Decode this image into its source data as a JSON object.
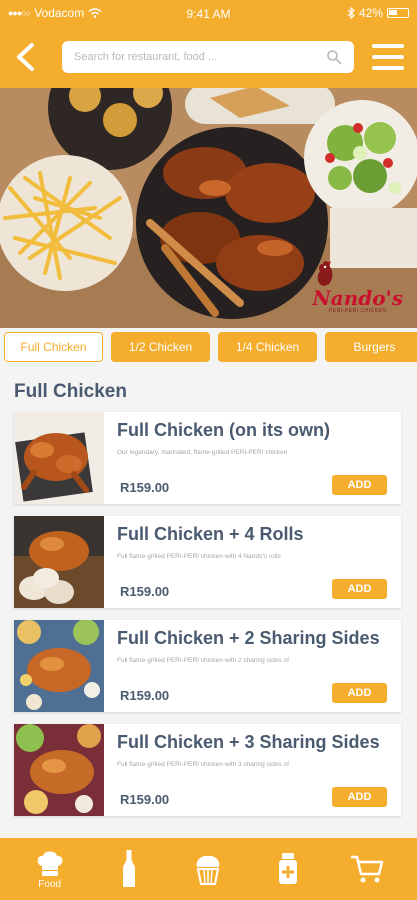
{
  "status": {
    "carrier": "Vodacom",
    "time": "9:41 AM",
    "battery": "42%"
  },
  "header": {
    "search_placeholder": "Search for restaurant, food ..."
  },
  "hero": {
    "brand": "Nando's",
    "brand_tagline": "PERI-PERI CHICKEN"
  },
  "tabs": [
    {
      "label": "Full Chicken",
      "active": true
    },
    {
      "label": "1/2 Chicken",
      "active": false
    },
    {
      "label": "1/4 Chicken",
      "active": false
    },
    {
      "label": "Burgers",
      "active": false
    }
  ],
  "section_title": "Full Chicken",
  "items": [
    {
      "name": "Full Chicken (on its own)",
      "description": "Our legendary, marinated, flame-grilled PERI-PERI chicken",
      "price": "R159.00",
      "add_label": "ADD"
    },
    {
      "name": "Full Chicken + 4 Rolls",
      "description": "Full flame-grilled PERI-PERI chicken with 4 Nando's rolls",
      "price": "R159.00",
      "add_label": "ADD"
    },
    {
      "name": "Full Chicken + 2 Sharing Sides",
      "description": "Full flame-grilled PERI-PERI chicken with 2 sharing sides of",
      "price": "R159.00",
      "add_label": "ADD"
    },
    {
      "name": "Full Chicken + 3 Sharing Sides",
      "description": "Full flame-grilled PERI-PERI chicken with 3 sharing sides of",
      "price": "R159.00",
      "add_label": "ADD"
    }
  ],
  "bottom_nav": [
    {
      "icon": "chef-hat-icon",
      "label": "Food"
    },
    {
      "icon": "bottle-icon",
      "label": ""
    },
    {
      "icon": "cupcake-icon",
      "label": ""
    },
    {
      "icon": "sauce-jar-icon",
      "label": ""
    },
    {
      "icon": "cart-icon",
      "label": ""
    }
  ],
  "colors": {
    "accent": "#f4ad2c",
    "text_dark": "#4a5a70",
    "brand_red": "#c8102e"
  }
}
